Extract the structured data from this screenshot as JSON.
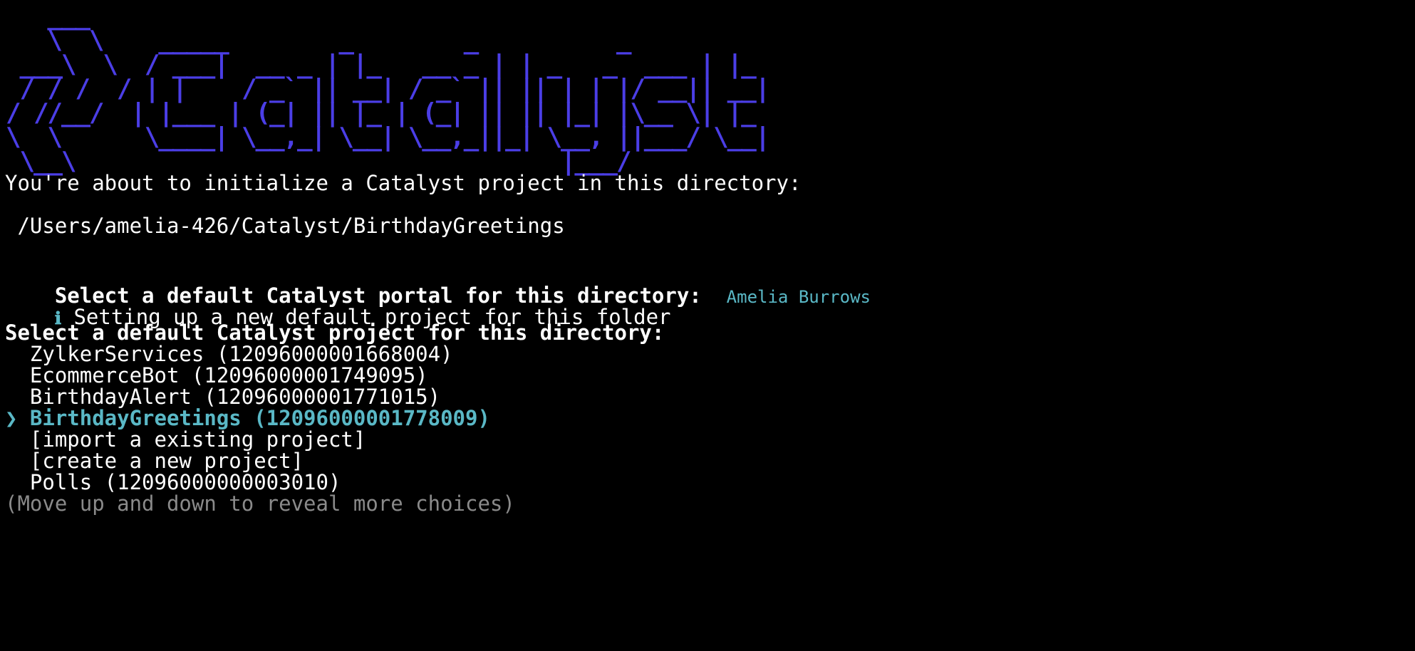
{
  "colors": {
    "background": "#000000",
    "text": "#ffffff",
    "logo": "#4b3ee6",
    "accent": "#5ab8c6",
    "hint": "#8a8a8a"
  },
  "logo_lines": [
    "   ___",
    "   \\  \\    _____        _        _          _",
    " ___\\  \\  / ___|  __ _ | |_   __ _ | | _   _  ___ | |_",
    " / / /  / | |    / _` || __| / _` || || | | |/ __|| __|",
    "/ //__/  | |___ | (_| || |_ | (_| || || |_| |\\__ \\| |_",
    "\\  \\      \\____| \\__,_| \\__| \\__,_||_| \\__, ||___/ \\__|",
    " \\__\\                                   |___/"
  ],
  "intro": {
    "message": "You're about to initialize a Catalyst project in this directory:",
    "directory": " /Users/amelia-426/Catalyst/BirthdayGreetings"
  },
  "portal": {
    "question": "Select a default Catalyst portal for this directory:",
    "answer": "Amelia Burrows"
  },
  "info": {
    "icon": "ℹ",
    "message": "Setting up a new default project for this folder"
  },
  "project_prompt": {
    "question": "Select a default Catalyst project for this directory:",
    "pointer": "❯",
    "choices": [
      {
        "label": "ZylkerServices (12096000001668004)",
        "selected": false
      },
      {
        "label": "EcommerceBot (12096000001749095)",
        "selected": false
      },
      {
        "label": "BirthdayAlert (12096000001771015)",
        "selected": false
      },
      {
        "label": "BirthdayGreetings (12096000001778009)",
        "selected": true
      },
      {
        "label": "[import a existing project]",
        "selected": false
      },
      {
        "label": "[create a new project]",
        "selected": false
      },
      {
        "label": "Polls (12096000000003010)",
        "selected": false
      }
    ],
    "hint": "(Move up and down to reveal more choices)"
  }
}
